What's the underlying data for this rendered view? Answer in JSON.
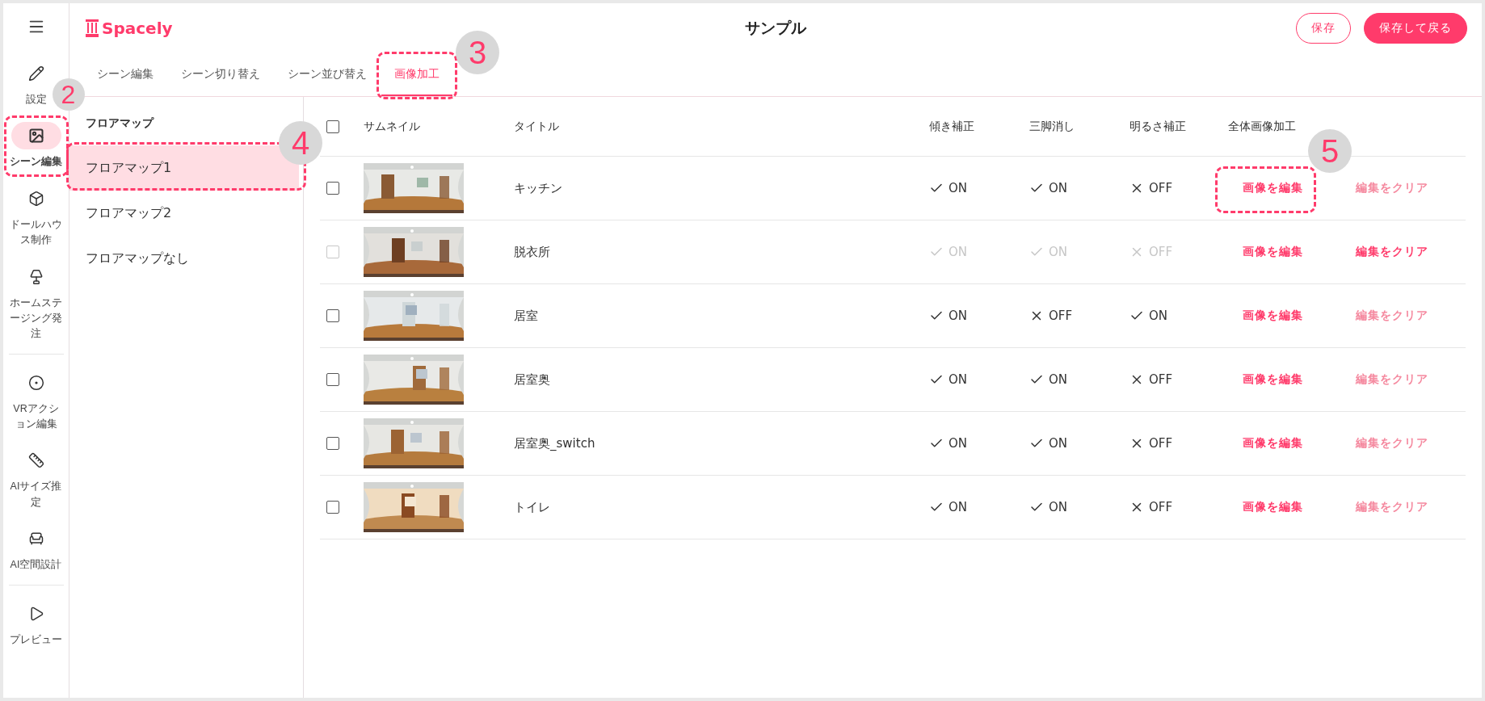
{
  "sidebar": {
    "items": [
      {
        "kind": "menu"
      },
      {
        "kind": "item",
        "label": "設定",
        "selected": false
      },
      {
        "kind": "item",
        "label": "シーン編集",
        "selected": true,
        "callout": "2"
      },
      {
        "kind": "item",
        "label": "ドールハウス制作",
        "selected": false
      },
      {
        "kind": "item",
        "label": "ホームステージング発注",
        "selected": false
      },
      {
        "kind": "divider"
      },
      {
        "kind": "item",
        "label": "VRアクション編集",
        "selected": false
      },
      {
        "kind": "item",
        "label": "AIサイズ推定",
        "selected": false
      },
      {
        "kind": "item",
        "label": "AI空間設計",
        "selected": false
      },
      {
        "kind": "divider"
      },
      {
        "kind": "item",
        "label": "プレビュー",
        "selected": false
      }
    ]
  },
  "header": {
    "logo": "Spacely",
    "title": "サンプル",
    "buttons": [
      {
        "label": "保存",
        "kind": "outline"
      },
      {
        "label": "保存して戻る",
        "kind": "filled"
      }
    ]
  },
  "tabs": [
    {
      "label": "シーン編集",
      "selected": false
    },
    {
      "label": "シーン切り替え",
      "selected": false
    },
    {
      "label": "シーン並び替え",
      "selected": false
    },
    {
      "label": "画像加工",
      "selected": true,
      "callout": "3"
    }
  ],
  "floor_maps": {
    "heading": "フロアマップ",
    "items": [
      {
        "label": "フロアマップ1",
        "selected": true,
        "callout": "4"
      },
      {
        "label": "フロアマップ2",
        "selected": false
      },
      {
        "label": "フロアマップなし",
        "selected": false
      }
    ]
  },
  "table": {
    "select_all": {
      "checked": false
    },
    "columns": [
      "サムネイル",
      "タイトル",
      "傾き補正",
      "三脚消し",
      "明るさ補正",
      "全体画像加工"
    ],
    "rows": [
      {
        "checked": false,
        "disabled": false,
        "thumbnail": {
          "kind": "picture"
        },
        "title": "キッチン",
        "values": [
          {
            "label": "ON",
            "on": true
          },
          {
            "label": "ON",
            "on": true
          },
          {
            "label": "OFF",
            "on": false
          }
        ],
        "edit": {
          "label": "画像を編集",
          "callout": "5"
        },
        "clear": {
          "label": "編集をクリア",
          "disabled": true
        }
      },
      {
        "checked": false,
        "disabled": true,
        "thumbnail": {
          "kind": "picture"
        },
        "title": "脱衣所",
        "values": [
          {
            "label": "ON",
            "on": true
          },
          {
            "label": "ON",
            "on": true
          },
          {
            "label": "OFF",
            "on": false
          }
        ],
        "edit": {
          "label": "画像を編集"
        },
        "clear": {
          "label": "編集をクリア",
          "disabled": false
        }
      },
      {
        "checked": false,
        "disabled": false,
        "thumbnail": {
          "kind": "picture"
        },
        "title": "居室",
        "values": [
          {
            "label": "ON",
            "on": true
          },
          {
            "label": "OFF",
            "on": false
          },
          {
            "label": "ON",
            "on": true
          }
        ],
        "edit": {
          "label": "画像を編集"
        },
        "clear": {
          "label": "編集をクリア",
          "disabled": true
        }
      },
      {
        "checked": false,
        "disabled": false,
        "thumbnail": {
          "kind": "picture"
        },
        "title": "居室奥",
        "values": [
          {
            "label": "ON",
            "on": true
          },
          {
            "label": "ON",
            "on": true
          },
          {
            "label": "OFF",
            "on": false
          }
        ],
        "edit": {
          "label": "画像を編集"
        },
        "clear": {
          "label": "編集をクリア",
          "disabled": true
        }
      },
      {
        "checked": false,
        "disabled": false,
        "thumbnail": {
          "kind": "picture"
        },
        "title": "居室奥_switch",
        "values": [
          {
            "label": "ON",
            "on": true
          },
          {
            "label": "ON",
            "on": true
          },
          {
            "label": "OFF",
            "on": false
          }
        ],
        "edit": {
          "label": "画像を編集"
        },
        "clear": {
          "label": "編集をクリア",
          "disabled": true
        }
      },
      {
        "checked": false,
        "disabled": false,
        "thumbnail": {
          "kind": "picture"
        },
        "title": "トイレ",
        "values": [
          {
            "label": "ON",
            "on": true
          },
          {
            "label": "ON",
            "on": true
          },
          {
            "label": "OFF",
            "on": false
          }
        ],
        "edit": {
          "label": "画像を編集"
        },
        "clear": {
          "label": "編集をクリア",
          "disabled": true
        }
      }
    ]
  }
}
